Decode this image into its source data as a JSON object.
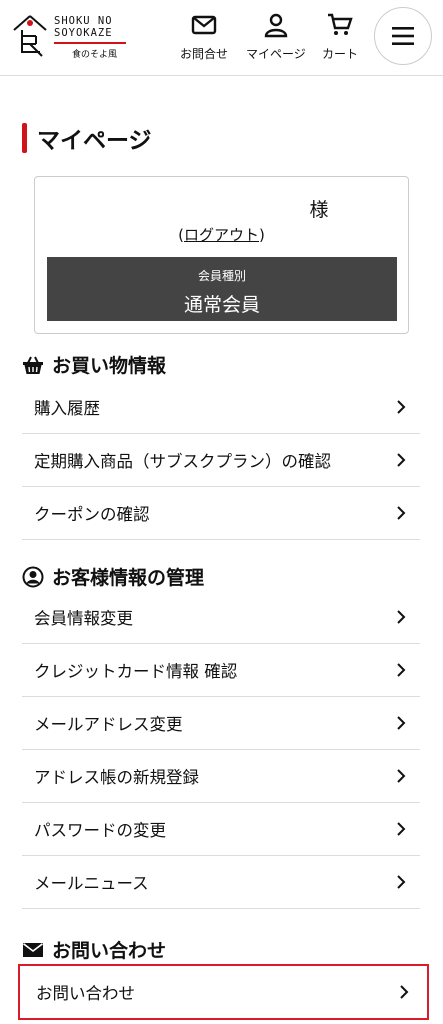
{
  "header": {
    "logo_en_line1": "SHOKU NO",
    "logo_en_line2": "SOYOKAZE",
    "logo_jp": "食のそよ風",
    "nav_contact": "お問合せ",
    "nav_mypage": "マイページ",
    "nav_cart": "カート",
    "brand_color": "#d0121b"
  },
  "page": {
    "title": "マイページ"
  },
  "member": {
    "name_suffix": "様",
    "logout_prefix": "(",
    "logout_link": "ログアウト",
    "logout_suffix": ")",
    "type_label": "会員種別",
    "type_value": "通常会員"
  },
  "shopping": {
    "heading": "お買い物情報",
    "items": [
      {
        "label": "購入履歴"
      },
      {
        "label": "定期購入商品（サブスクプラン）の確認"
      },
      {
        "label": "クーポンの確認"
      }
    ]
  },
  "account": {
    "heading": "お客様情報の管理",
    "items": [
      {
        "label": "会員情報変更"
      },
      {
        "label": "クレジットカード情報 確認"
      },
      {
        "label": "メールアドレス変更"
      },
      {
        "label": "アドレス帳の新規登録"
      },
      {
        "label": "パスワードの変更"
      },
      {
        "label": "メールニュース"
      }
    ]
  },
  "inquiry": {
    "heading": "お問い合わせ",
    "items": [
      {
        "label": "お問い合わせ"
      }
    ]
  }
}
